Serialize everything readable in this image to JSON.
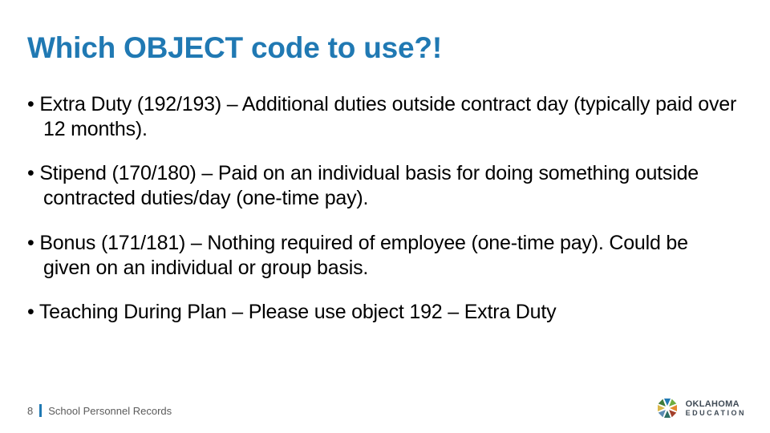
{
  "title": "Which OBJECT code to use?!",
  "bullets": [
    "Extra Duty (192/193) – Additional duties outside contract day (typically paid over 12 months).",
    "Stipend (170/180) – Paid on an individual basis for doing something outside contracted duties/day (one-time pay).",
    "Bonus (171/181) – Nothing required of employee (one-time pay). Could be given on an individual or group basis.",
    "Teaching During Plan – Please use object 192 – Extra Duty"
  ],
  "footer": {
    "page_number": "8",
    "label": "School Personnel Records"
  },
  "logo": {
    "line1": "OKLAHOMA",
    "line2": "EDUCATION",
    "petal_colors": [
      "#2079b3",
      "#6fae3f",
      "#e58a2e",
      "#a33f2a",
      "#2c6e64",
      "#5c8cb3",
      "#d9b84a",
      "#3f7a3a"
    ]
  }
}
